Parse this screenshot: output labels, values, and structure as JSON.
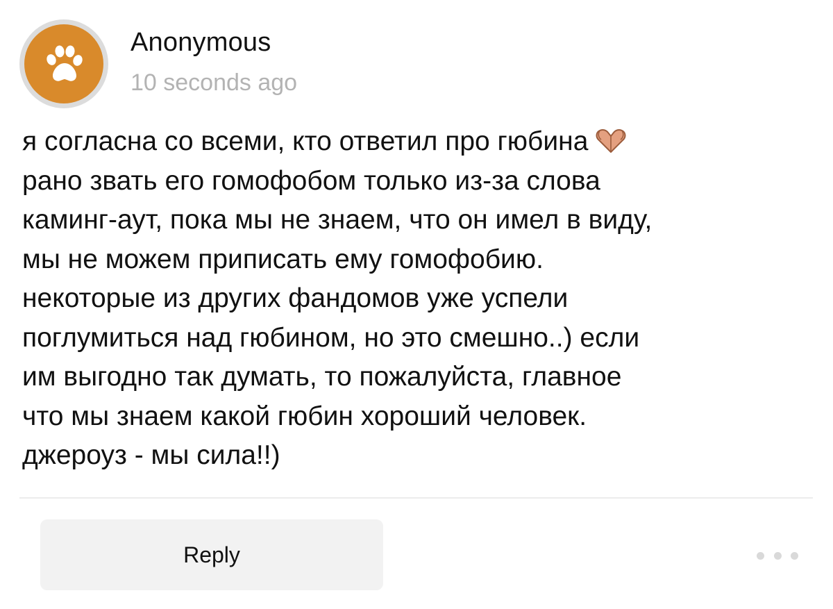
{
  "comment": {
    "author": "Anonymous",
    "timestamp": "10 seconds ago",
    "avatar_icon": "paw-icon",
    "avatar_color": "#d98a2b",
    "emoji": "heart-hands-icon",
    "lines": [
      "я согласна со всеми, кто ответил про гюбина",
      "рано звать его гомофобом только из-за слова",
      "каминг-аут, пока мы не знаем, что он имел в виду,",
      "мы не можем приписать ему гомофобию.",
      "некоторые из других фандомов уже успели",
      "поглумиться над гюбином, но это смешно..) если",
      "им выгодно так думать, то пожалуйста, главное",
      "что мы знаем какой гюбин хороший человек.",
      "джероуз - мы сила!!)"
    ]
  },
  "actions": {
    "reply_label": "Reply",
    "more_icon": "more-dots-icon"
  }
}
